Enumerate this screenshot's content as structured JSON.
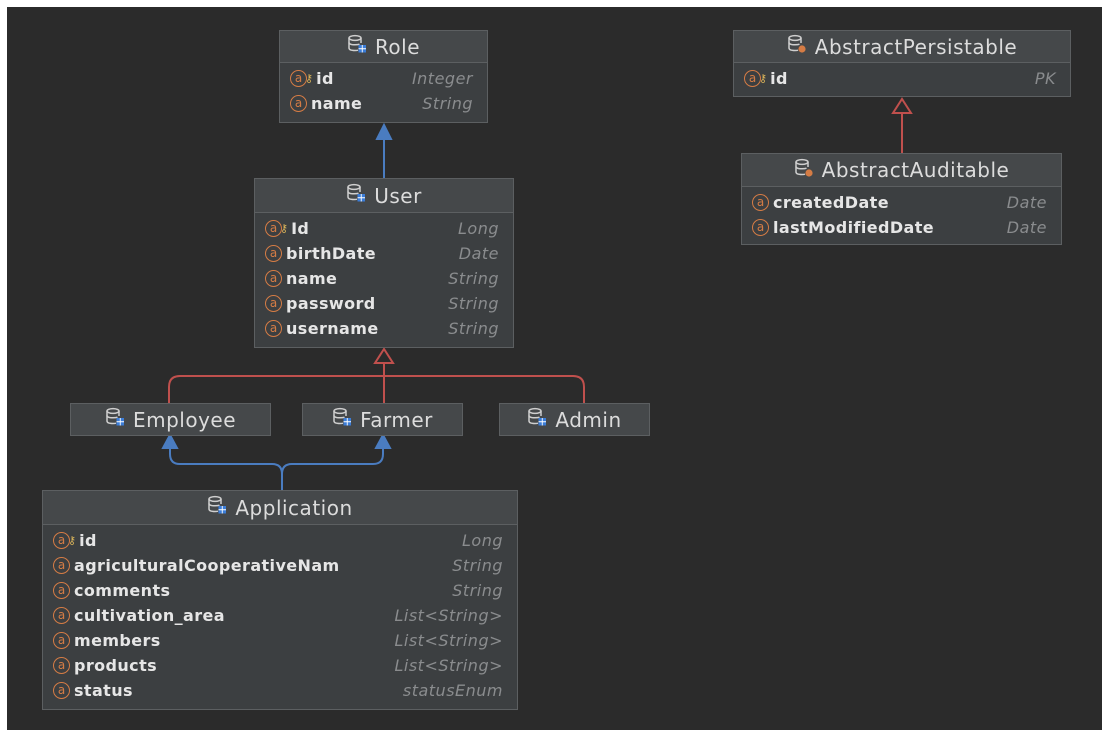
{
  "colors": {
    "canvas": "#2b2b2b",
    "entity_bg": "#3c3f41",
    "field_badge": "#d57c45",
    "association_arrow": "#4a7cc0",
    "inheritance_arrow": "#c0504d"
  },
  "entities": {
    "role": {
      "name": "Role",
      "fields": [
        {
          "name": "id",
          "type": "Integer",
          "key": true
        },
        {
          "name": "name",
          "type": "String",
          "key": false
        }
      ]
    },
    "user": {
      "name": "User",
      "fields": [
        {
          "name": "Id",
          "type": "Long",
          "key": true
        },
        {
          "name": "birthDate",
          "type": "Date",
          "key": false
        },
        {
          "name": "name",
          "type": "String",
          "key": false
        },
        {
          "name": "password",
          "type": "String",
          "key": false
        },
        {
          "name": "username",
          "type": "String",
          "key": false
        }
      ]
    },
    "employee": {
      "name": "Employee"
    },
    "farmer": {
      "name": "Farmer"
    },
    "admin": {
      "name": "Admin"
    },
    "application": {
      "name": "Application",
      "fields": [
        {
          "name": "id",
          "type": "Long",
          "key": true
        },
        {
          "name": "agriculturalCooperativeNam",
          "type": "String",
          "key": false
        },
        {
          "name": "comments",
          "type": "String",
          "key": false
        },
        {
          "name": "cultivation_area",
          "type": "List<String>",
          "key": false
        },
        {
          "name": "members",
          "type": "List<String>",
          "key": false
        },
        {
          "name": "products",
          "type": "List<String>",
          "key": false
        },
        {
          "name": "status",
          "type": "statusEnum",
          "key": false
        }
      ]
    },
    "abstract_persistable": {
      "name": "AbstractPersistable",
      "fields": [
        {
          "name": "id",
          "type": "PK",
          "key": true
        }
      ]
    },
    "abstract_auditable": {
      "name": "AbstractAuditable",
      "fields": [
        {
          "name": "createdDate",
          "type": "Date",
          "key": false
        },
        {
          "name": "lastModifiedDate",
          "type": "Date",
          "key": false
        }
      ]
    }
  },
  "field_badge_letter": "a",
  "relations": [
    {
      "from": "User",
      "to": "Role",
      "kind": "association"
    },
    {
      "from": "Employee",
      "to": "User",
      "kind": "inheritance"
    },
    {
      "from": "Farmer",
      "to": "User",
      "kind": "inheritance"
    },
    {
      "from": "Admin",
      "to": "User",
      "kind": "inheritance"
    },
    {
      "from": "Application",
      "to": "Employee",
      "kind": "association"
    },
    {
      "from": "Application",
      "to": "Farmer",
      "kind": "association"
    },
    {
      "from": "AbstractAuditable",
      "to": "AbstractPersistable",
      "kind": "inheritance"
    }
  ]
}
